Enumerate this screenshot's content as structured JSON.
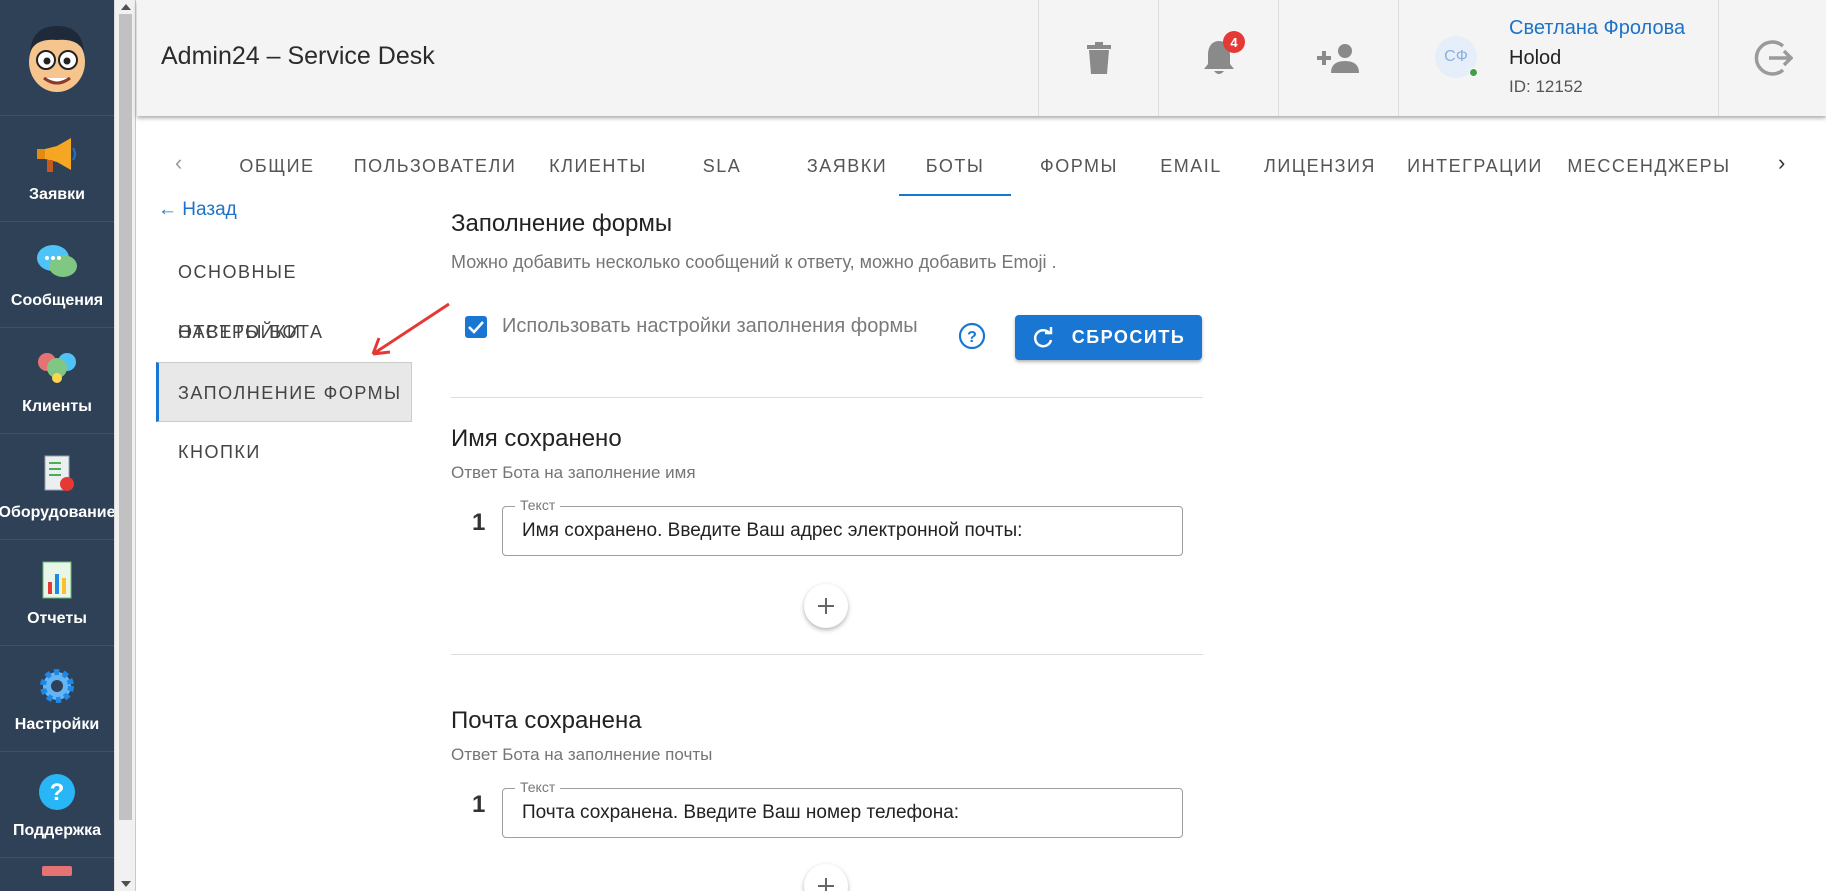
{
  "app": {
    "title": "Admin24 – Service Desk"
  },
  "sidebar": {
    "items": [
      {
        "label": "Заявки",
        "icon": "megaphone-icon"
      },
      {
        "label": "Сообщения",
        "icon": "chat-bubbles-icon"
      },
      {
        "label": "Клиенты",
        "icon": "clients-icon"
      },
      {
        "label": "Оборудование",
        "icon": "equipment-icon"
      },
      {
        "label": "Отчеты",
        "icon": "reports-icon"
      },
      {
        "label": "Настройки",
        "icon": "gear-icon"
      },
      {
        "label": "Поддержка",
        "icon": "help-icon"
      }
    ]
  },
  "header": {
    "notifications_count": "4",
    "user": {
      "initials": "СФ",
      "name": "Светлана Фролова",
      "org": "Holod",
      "id": "ID: 12152"
    }
  },
  "tabs": [
    "ОБЩИЕ",
    "ПОЛЬЗОВАТЕЛИ",
    "КЛИЕНТЫ",
    "SLA",
    "ЗАЯВКИ",
    "БОТЫ",
    "ФОРМЫ",
    "EMAIL",
    "ЛИЦЕНЗИЯ",
    "ИНТЕГРАЦИИ",
    "МЕССЕНДЖЕРЫ"
  ],
  "active_tab": "БОТЫ",
  "subnav": {
    "back_label": "Назад",
    "items": [
      "ОСНОВНЫЕ НАСТРОЙКИ",
      "ОТВЕТЫ БОТА",
      "ЗАПОЛНЕНИЕ ФОРМЫ",
      "КНОПКИ"
    ],
    "active": "ЗАПОЛНЕНИЕ ФОРМЫ"
  },
  "main": {
    "title": "Заполнение формы",
    "description": "Можно добавить несколько сообщений к ответу, можно добавить Emoji .",
    "use_settings_label": "Использовать настройки заполнения формы",
    "use_settings_checked": true,
    "reset_label": "СБРОСИТЬ",
    "sections": [
      {
        "title": "Имя сохранено",
        "description": "Ответ Бота на заполнение имя",
        "number": "1",
        "field_label": "Текст",
        "value": "Имя сохранено. Введите Ваш адрес электронной почты:"
      },
      {
        "title": "Почта сохранена",
        "description": "Ответ Бота на заполнение почты",
        "number": "1",
        "field_label": "Текст",
        "value": "Почта сохранена. Введите Ваш номер телефона:"
      }
    ]
  },
  "colors": {
    "accent": "#1976d2",
    "sidebar": "#2f4156",
    "badge": "#e53935"
  }
}
